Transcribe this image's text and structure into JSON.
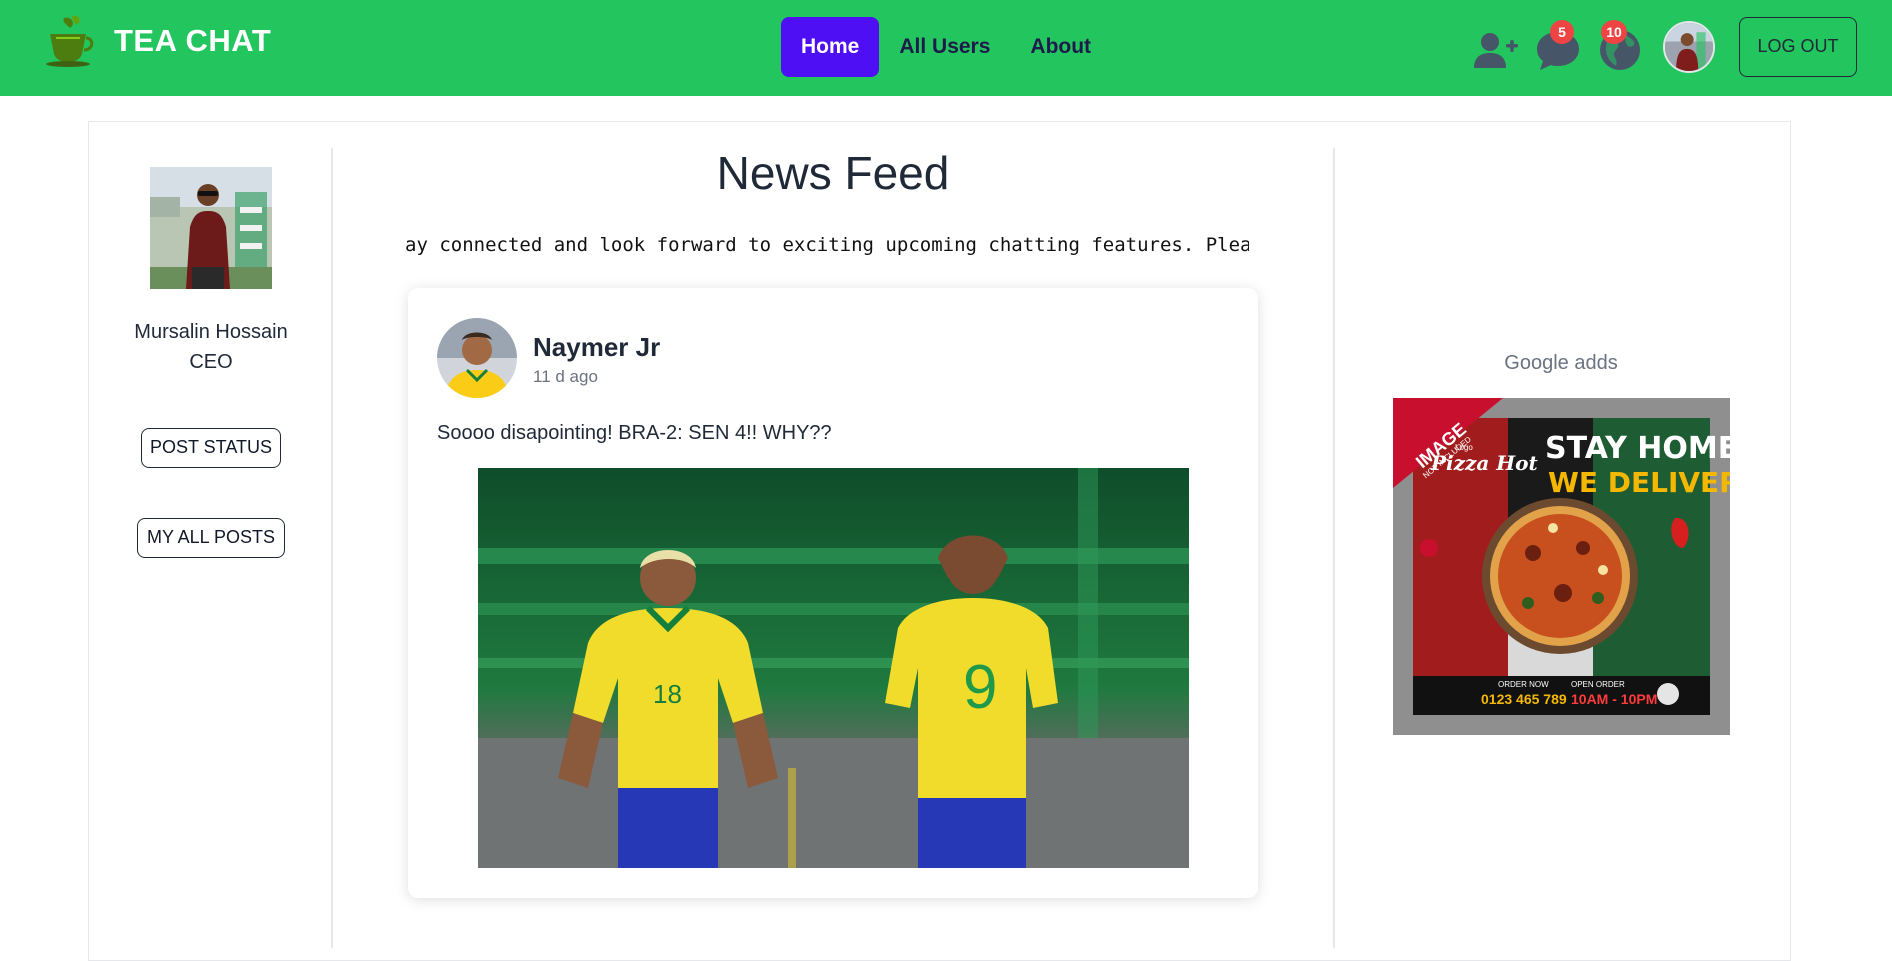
{
  "navbar": {
    "brand": "TEA CHAT",
    "links": [
      {
        "label": "Home",
        "active": true
      },
      {
        "label": "All Users",
        "active": false
      },
      {
        "label": "About",
        "active": false
      }
    ],
    "icons": {
      "add_friend": "add-user-icon",
      "messages": {
        "icon": "chat-bubble-icon",
        "badge": "5"
      },
      "notifications": {
        "icon": "globe-icon",
        "badge": "10"
      }
    },
    "logout_label": "LOG OUT",
    "accent_color": "#22c55e",
    "active_link_color": "#4f0ff5"
  },
  "profile": {
    "name": "Mursalin Hossain",
    "role": "CEO",
    "post_status_label": "POST STATUS",
    "my_posts_label": "MY ALL POSTS"
  },
  "feed": {
    "title": "News Feed",
    "marquee": "ay connected and look forward to exciting upcoming chatting features. Please",
    "posts": [
      {
        "author": "Naymer Jr",
        "time": "11 d ago",
        "text": "Soooo disapointing! BRA-2: SEN 4!! WHY??",
        "image_desc": "football-players-photo"
      }
    ]
  },
  "ads": {
    "label": "Google adds",
    "ad": {
      "corner_tag_line1": "IMAGE",
      "corner_tag_line2": "NOT INCLUDED",
      "logo_small": "Logo",
      "brand": "Pizza Hot",
      "headline_1": "STAY HOME",
      "headline_2": "WE DELIVER",
      "order_now_label": "ORDER NOW",
      "phone": "0123 465 789",
      "open_order_label": "OPEN ORDER",
      "hours": "10AM - 10PM"
    }
  }
}
